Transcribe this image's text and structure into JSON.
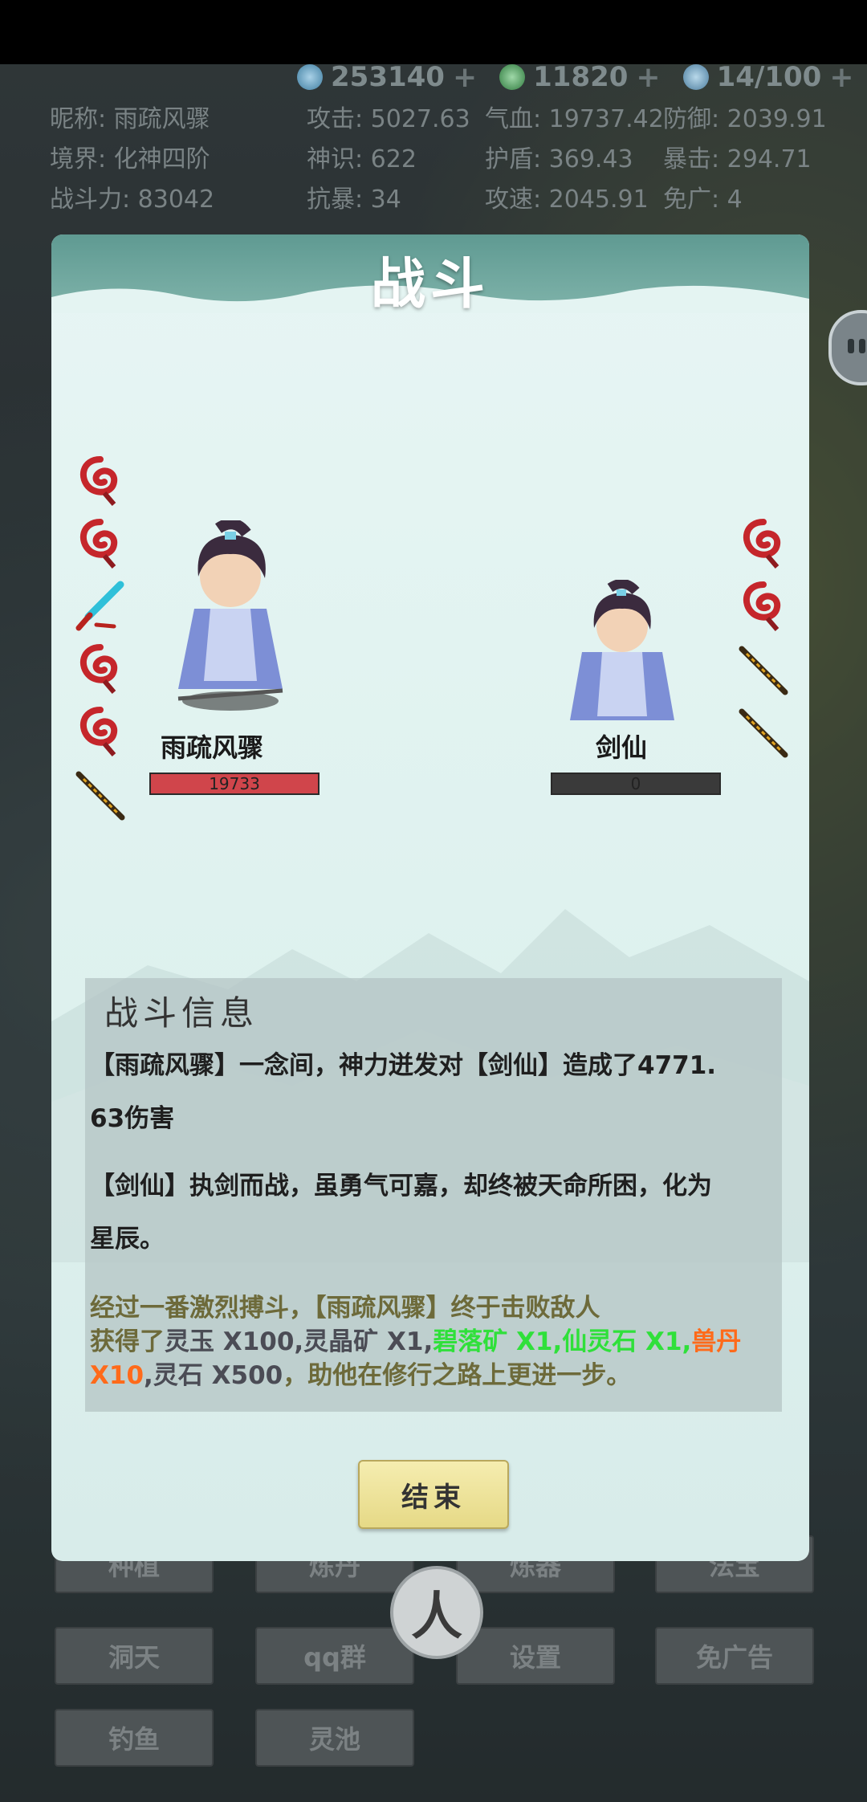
{
  "currency": [
    {
      "icon": "spirit-jade-icon",
      "value": "253140",
      "color": "#6fa7c7"
    },
    {
      "icon": "spirit-crystal-icon",
      "value": "11820",
      "color": "#5cab6d"
    },
    {
      "icon": "stamina-icon",
      "value": "14/100",
      "color": "#6ea2c4"
    }
  ],
  "stats": {
    "row1": [
      "昵称: 雨疏风骤",
      "攻击: 5027.63",
      "气血: 19737.42",
      "防御: 2039.91"
    ],
    "row2": [
      "境界: 化神四阶",
      "神识: 622",
      "护盾: 369.43",
      "暴击: 294.71"
    ],
    "row3": [
      "战斗力: 83042",
      "抗暴: 34",
      "攻速: 2045.91",
      "免广: 4"
    ]
  },
  "dialog": {
    "title": "战斗",
    "player": {
      "name": "雨疏风骤",
      "hp": "19733"
    },
    "enemy": {
      "name": "剑仙",
      "hp": "0"
    },
    "left_icons": [
      "dragon-icon",
      "dragon-icon",
      "jade-brush-icon",
      "dragon-icon",
      "dragon-icon",
      "flame-sword-icon"
    ],
    "right_icons": [
      "dragon-icon",
      "dragon-icon",
      "flame-sword-icon",
      "flame-sword-icon"
    ],
    "info": {
      "title": "战斗信息",
      "line1a": "【雨疏风骤】一念间，神力迸发对【剑仙】造成了4771.",
      "line1b": "63伤害",
      "line2a": "【剑仙】执剑而战，虽勇气可嘉，却终被天命所困，化为",
      "line2b": "星辰。",
      "summary1": "经过一番激烈搏斗，【雨疏风骤】终于击败敌人",
      "reward_prefix": "获得了",
      "reward1": "灵玉 X100,灵晶矿 X1,",
      "reward2": "碧落矿 X1,仙灵石 X1,",
      "reward3": "兽丹",
      "reward4": "X10",
      "reward5": ",灵石 X500",
      "reward_suffix": "，助他在修行之路上更进一步。"
    },
    "end_button": "结束"
  },
  "menu": [
    "种植",
    "炼丹",
    "炼器",
    "法宝",
    "洞天",
    "qq群",
    "设置",
    "免广告",
    "钓鱼",
    "灵池"
  ],
  "center_button": "人"
}
